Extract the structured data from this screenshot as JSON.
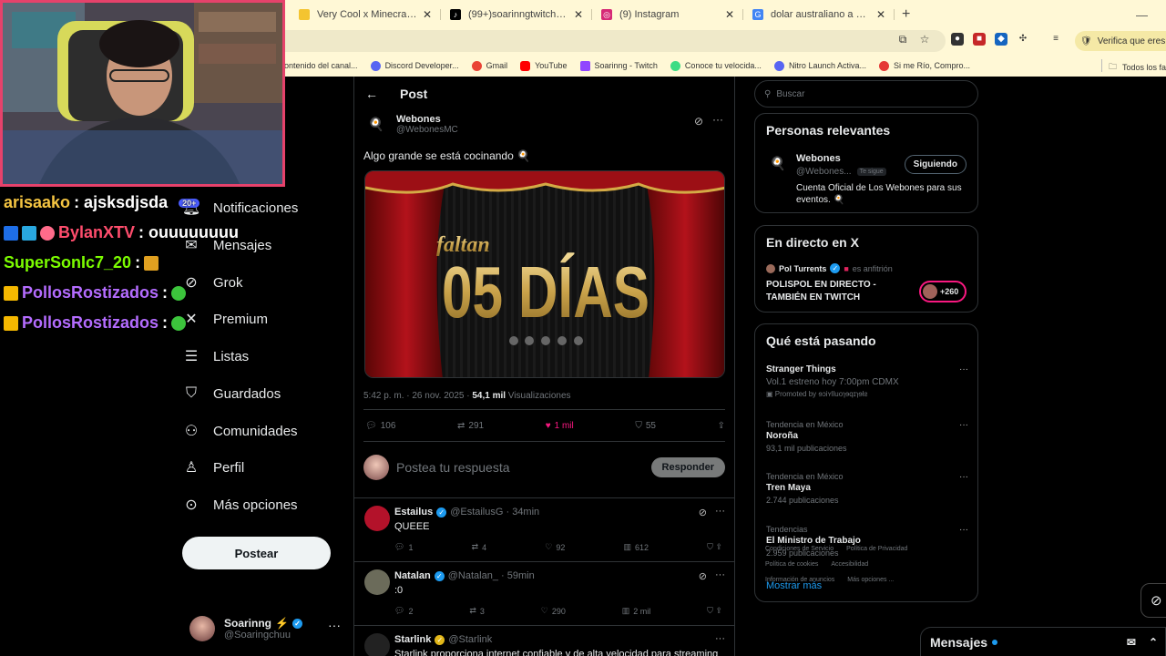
{
  "browser": {
    "tabs": [
      {
        "title": "Very Cool x Minecraft- Cool Sh",
        "icon_color": "#f4c430"
      },
      {
        "title": "(99+)soarinngtwitch (@soarinn",
        "icon_color": "#000000"
      },
      {
        "title": "(9) Instagram",
        "icon_color": "#d62976"
      },
      {
        "title": "dolar australiano a pesos - Bus",
        "icon_color": "#4285f4"
      }
    ],
    "verify_label": "Verifica que eres tú",
    "bookmarks": [
      {
        "label": "ontenido del canal...",
        "color": "#ff0000"
      },
      {
        "label": "Discord Developer...",
        "color": "#5865f2"
      },
      {
        "label": "Gmail",
        "color": "#ea4335"
      },
      {
        "label": "YouTube",
        "color": "#ff0000"
      },
      {
        "label": "Soarinng - Twitch",
        "color": "#9146ff"
      },
      {
        "label": "Conoce tu velocida...",
        "color": "#3ddc84"
      },
      {
        "label": "Nitro Launch Activa...",
        "color": "#5865f2"
      },
      {
        "label": "Si me Río, Compro...",
        "color": "#e53935"
      }
    ],
    "all_bookmarks_label": "Todos los fa"
  },
  "nav": {
    "items": [
      {
        "label": "Notificaciones",
        "icon": "bell-icon",
        "glyph": "🔔"
      },
      {
        "label": "Mensajes",
        "icon": "mail-icon",
        "glyph": "✉"
      },
      {
        "label": "Grok",
        "icon": "grok-icon",
        "glyph": "⊘"
      },
      {
        "label": "Premium",
        "icon": "x-logo-icon",
        "glyph": "𝕏"
      },
      {
        "label": "Listas",
        "icon": "list-icon",
        "glyph": "☰"
      },
      {
        "label": "Guardados",
        "icon": "bookmark-icon",
        "glyph": "🔖"
      },
      {
        "label": "Comunidades",
        "icon": "communities-icon",
        "glyph": "👥"
      },
      {
        "label": "Perfil",
        "icon": "person-icon",
        "glyph": "👤"
      },
      {
        "label": "Más opciones",
        "icon": "more-circle-icon",
        "glyph": "⋯"
      }
    ],
    "post_button": "Postear",
    "profile": {
      "name": "Soarinng",
      "handle": "@Soaringchuu",
      "emoji": "⚡"
    }
  },
  "post": {
    "header_title": "Post",
    "author_name": "Webones",
    "author_handle": "@WebonesMC",
    "text": "Algo grande se está cocinando 🍳",
    "image_small_text": "faltan",
    "image_big_text": "05 DÍAS",
    "timestamp": "5:42 p. m. · 26 nov. 2025 · ",
    "views_count": "54,1 mil",
    "views_label": " Visualizaciones",
    "stats": {
      "replies": "106",
      "reposts": "291",
      "likes": "1 mil",
      "bookmarks": "55"
    },
    "reply_placeholder": "Postea tu respuesta",
    "reply_button": "Responder"
  },
  "replies": [
    {
      "name": "Estailus",
      "handle": "@EstailusG · 34min",
      "body": "QUEEE",
      "replies": "1",
      "reposts": "4",
      "likes": "92",
      "views": "612",
      "avatar_color": "#b3122a",
      "badge_color": "#1d9bf0"
    },
    {
      "name": "Natalan",
      "handle": "@Natalan_ · 59min",
      "body": ":0",
      "replies": "2",
      "reposts": "3",
      "likes": "290",
      "views": "2 mil",
      "avatar_color": "#6b6b5a",
      "badge_color": "#1d9bf0"
    },
    {
      "name": "Starlink",
      "handle": "@Starlink",
      "body": "Starlink proporciona internet confiable y de alta velocidad para streaming",
      "replies": "",
      "reposts": "",
      "likes": "",
      "views": "",
      "avatar_color": "#222222",
      "badge_color": "#e2b719"
    }
  ],
  "sidebar": {
    "search_placeholder": "Buscar",
    "relevant": {
      "title": "Personas relevantes",
      "name": "Webones",
      "handle": "@Webones...",
      "follows_you": "Te sigue",
      "follow_button": "Siguiendo",
      "bio": "Cuenta Oficial de Los Webones para sus eventos. 🍳"
    },
    "live": {
      "title": "En directo en X",
      "host": "Pol Turrents",
      "host_suffix": "es anfitrión",
      "stream_title": "POLISPOL EN DIRECTO - TAMBIÉN EN TWITCH",
      "listeners": "+260"
    },
    "trends_title": "Qué está pasando",
    "trends": [
      {
        "context": "",
        "title": "Stranger Things",
        "sub": "Vol.1 estreno hoy 7:00pm CDMX",
        "extra": "Promoted by ɘɔiʏlluoɿɘqɪɿɘƚƨ"
      },
      {
        "context": "Tendencia en México",
        "title": "Noroña",
        "sub": "93,1 mil publicaciones",
        "extra": ""
      },
      {
        "context": "Tendencia en México",
        "title": "Tren Maya",
        "sub": "2.744 publicaciones",
        "extra": ""
      },
      {
        "context": "Tendencias",
        "title": "El Ministro de Trabajo",
        "sub": "2.959 publicaciones",
        "extra": ""
      }
    ],
    "show_more": "Mostrar más",
    "footer": [
      "Condiciones de Servicio",
      "Política de Privacidad",
      "Política de cookies",
      "Accesibilidad",
      "Información de anuncios",
      "Más opciones ..."
    ]
  },
  "messages_bar": {
    "label": "Mensajes"
  },
  "stream_chat": [
    {
      "user": "arisaako",
      "msg": ": ajsksdjsda",
      "color": "#f5c542",
      "extra": "20+"
    },
    {
      "user": "BylanXTV",
      "msg": ": ouuuuuuuu",
      "color": "#ff4d6d",
      "extra": ""
    },
    {
      "user": "SuperSonIc7_20",
      "msg": ":",
      "color": "#7CFC00",
      "extra": ""
    },
    {
      "user": "PollosRostizados",
      "msg": ":",
      "color": "#b46cff",
      "extra": ""
    },
    {
      "user": "PollosRostizados",
      "msg": ":",
      "color": "#b46cff",
      "extra": ""
    }
  ]
}
